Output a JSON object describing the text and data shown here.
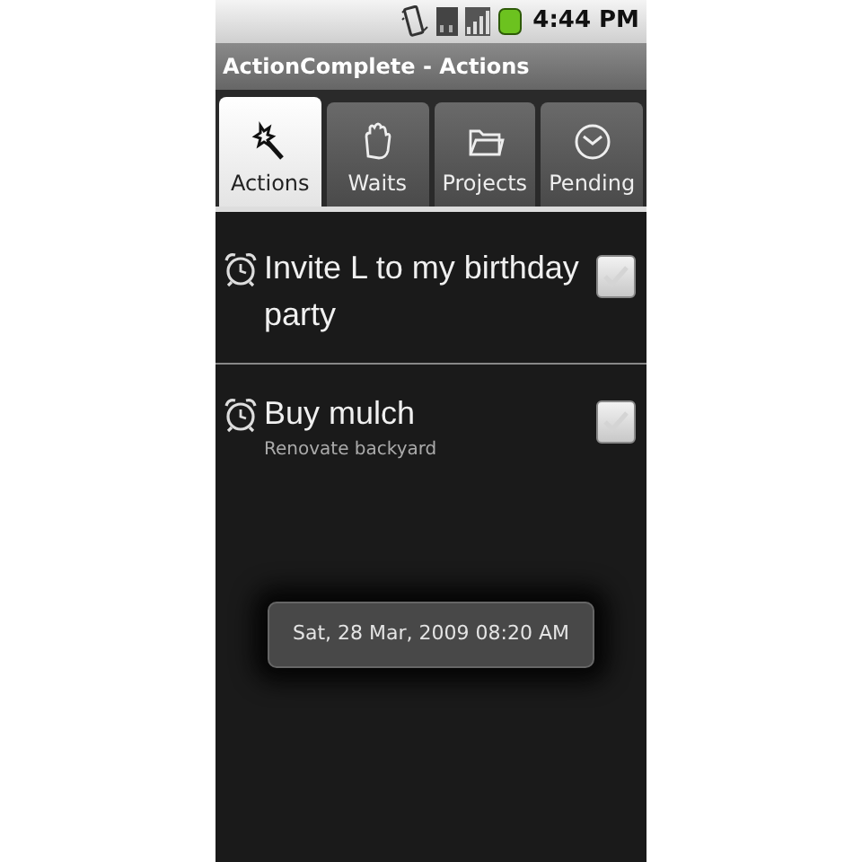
{
  "status_bar": {
    "time": "4:44 PM"
  },
  "window": {
    "title": "ActionComplete - Actions"
  },
  "tabs": [
    {
      "label": "Actions",
      "kind": "wand",
      "selected": true
    },
    {
      "label": "Waits",
      "kind": "hand",
      "selected": false
    },
    {
      "label": "Projects",
      "kind": "folder",
      "selected": false
    },
    {
      "label": "Pending",
      "kind": "clock",
      "selected": false
    }
  ],
  "actions": [
    {
      "title": "Invite L to my birthday party",
      "checked": false
    },
    {
      "title": "Buy mulch",
      "project": "Renovate backyard",
      "checked": false
    }
  ],
  "toast": {
    "text": "Sat, 28 Mar, 2009 08:20 AM"
  }
}
